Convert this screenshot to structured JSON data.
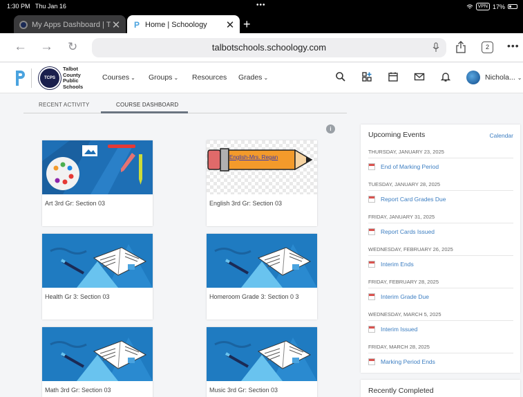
{
  "status": {
    "time": "1:30 PM",
    "date": "Thu Jan 16",
    "vpn": "VPN",
    "battery": "17%"
  },
  "tabs": [
    {
      "title": "My Apps Dashboard | Ta",
      "close": "✕"
    },
    {
      "title": "Home | Schoology",
      "close": "✕"
    }
  ],
  "new_tab": "+",
  "address": {
    "url": "talbotschools.schoology.com",
    "tab_count": "2"
  },
  "header": {
    "district_lines": [
      "Talbot",
      "County",
      "Public",
      "Schools"
    ],
    "seal_text": "TCPS",
    "menu": [
      {
        "label": "Courses",
        "chevron": "⌄"
      },
      {
        "label": "Groups",
        "chevron": "⌄"
      },
      {
        "label": "Resources",
        "chevron": ""
      },
      {
        "label": "Grades",
        "chevron": "⌄"
      }
    ],
    "user": "Nichola...",
    "user_chevron": "⌄"
  },
  "subtabs": {
    "recent": "RECENT ACTIVITY",
    "dashboard": "COURSE DASHBOARD"
  },
  "courses": [
    {
      "name": "Art 3rd Gr: Section 03",
      "image": "art"
    },
    {
      "name": "English 3rd Gr: Section 03",
      "image": "pencil",
      "pencil_text": "English-Mrs. Regan"
    },
    {
      "name": "Health Gr 3: Section 03",
      "image": "book"
    },
    {
      "name": "Homeroom Grade 3: Section 0 3",
      "image": "book"
    },
    {
      "name": "Math 3rd Gr: Section 03",
      "image": "book"
    },
    {
      "name": "Music 3rd Gr: Section 03",
      "image": "book"
    }
  ],
  "events": {
    "title": "Upcoming Events",
    "calendar_link": "Calendar",
    "groups": [
      {
        "date": "THURSDAY, JANUARY 23, 2025",
        "day": "23",
        "item": "End of Marking Period"
      },
      {
        "date": "TUESDAY, JANUARY 28, 2025",
        "day": "28",
        "item": "Report Card Grades Due"
      },
      {
        "date": "FRIDAY, JANUARY 31, 2025",
        "day": "31",
        "item": "Report Cards Issued"
      },
      {
        "date": "WEDNESDAY, FEBRUARY 26, 2025",
        "day": "26",
        "item": "Interim Ends"
      },
      {
        "date": "FRIDAY, FEBRUARY 28, 2025",
        "day": "28",
        "item": "Interim Grade Due"
      },
      {
        "date": "WEDNESDAY, MARCH 5, 2025",
        "day": "5",
        "item": "Interim Issued"
      },
      {
        "date": "FRIDAY, MARCH 28, 2025",
        "day": "28",
        "item": "Marking Period Ends"
      }
    ]
  },
  "recently_completed": {
    "title": "Recently Completed"
  },
  "colors": {
    "link": "#3b7dc1",
    "course_blue": "#1f7bc1",
    "pencil_orange": "#f39a2b"
  }
}
